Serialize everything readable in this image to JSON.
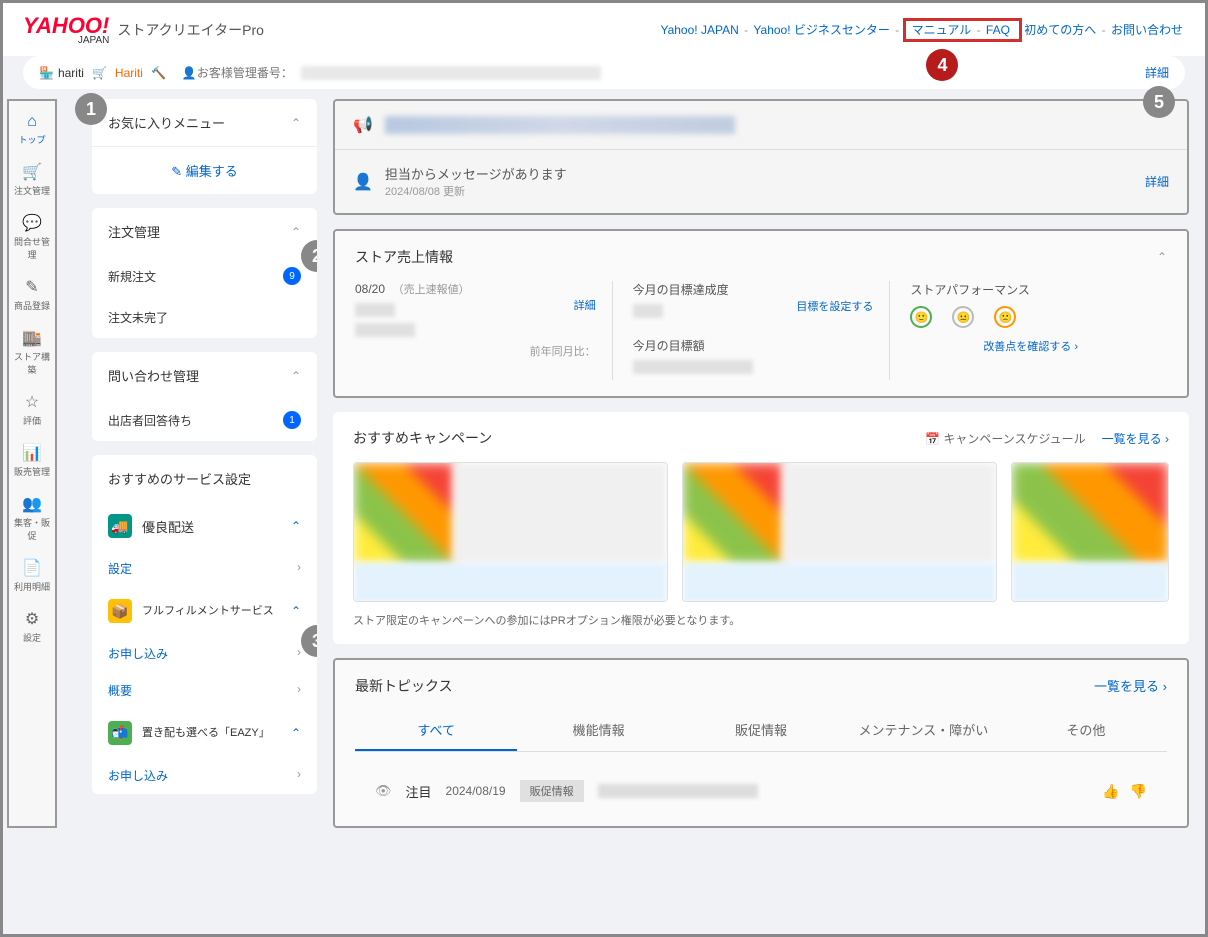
{
  "header": {
    "logo_main": "YAHOO!",
    "logo_sub": "JAPAN",
    "product": "ストアクリエイターPro",
    "links": [
      "Yahoo! JAPAN",
      "Yahoo! ビジネスセンター",
      "マニュアル",
      "FAQ",
      "初めての方へ",
      "お問い合わせ"
    ]
  },
  "subheader": {
    "store1": "hariti",
    "store2": "Hariti",
    "customer_label": "お客様管理番号：",
    "detail": "詳細"
  },
  "iconbar": [
    {
      "icon": "⌂",
      "label": "トップ"
    },
    {
      "icon": "🛒",
      "label": "注文管理"
    },
    {
      "icon": "💬",
      "label": "問合せ管理"
    },
    {
      "icon": "✎",
      "label": "商品登録"
    },
    {
      "icon": "🏬",
      "label": "ストア構築"
    },
    {
      "icon": "☆",
      "label": "評価"
    },
    {
      "icon": "📊",
      "label": "販売管理"
    },
    {
      "icon": "👥",
      "label": "集客・販促"
    },
    {
      "icon": "📄",
      "label": "利用明細"
    },
    {
      "icon": "⚙",
      "label": "設定"
    }
  ],
  "sidepanel": {
    "favorite": {
      "title": "お気に入りメニュー",
      "edit": "編集する"
    },
    "orders": {
      "title": "注文管理",
      "items": [
        {
          "label": "新規注文",
          "badge": "9"
        },
        {
          "label": "注文未完了"
        }
      ]
    },
    "inquiry": {
      "title": "問い合わせ管理",
      "items": [
        {
          "label": "出店者回答待ち",
          "badge": "1"
        }
      ]
    },
    "services": {
      "title": "おすすめのサービス設定",
      "items": [
        {
          "name": "優良配送",
          "links": [
            "設定"
          ]
        },
        {
          "name": "フルフィルメントサービス",
          "links": [
            "お申し込み",
            "概要"
          ]
        },
        {
          "name": "置き配も選べる「EAZY」",
          "links": [
            "お申し込み"
          ]
        }
      ]
    }
  },
  "notice": {
    "msg_title": "担当からメッセージがあります",
    "msg_date": "2024/08/08 更新",
    "detail": "詳細"
  },
  "sales": {
    "title": "ストア売上情報",
    "col1_date": "08/20",
    "col1_sub": "（売上速報値）",
    "col1_detail": "詳細",
    "col1_prev": "前年同月比：",
    "col2_l1": "今月の目標達成度",
    "col2_link": "目標を設定する",
    "col2_l2": "今月の目標額",
    "col3_l": "ストアパフォーマンス",
    "col3_link": "改善点を確認する ›"
  },
  "campaign": {
    "title": "おすすめキャンペーン",
    "schedule": "キャンペーンスケジュール",
    "all": "一覧を見る ›",
    "note": "ストア限定のキャンペーンへの参加にはPRオプション権限が必要となります。"
  },
  "topics": {
    "title": "最新トピックス",
    "all": "一覧を見る ›",
    "tabs": [
      "すべて",
      "機能情報",
      "販促情報",
      "メンテナンス・障がい",
      "その他"
    ],
    "row": {
      "attention": "注目",
      "date": "2024/08/19",
      "tag": "販促情報"
    }
  },
  "markers": {
    "m1": "1",
    "m2": "2",
    "m3": "3",
    "m4": "4",
    "m5": "5"
  }
}
